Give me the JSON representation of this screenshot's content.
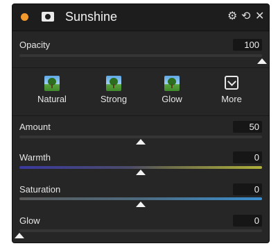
{
  "panel": {
    "title": "Sunshine",
    "accent_color": "#f39a2e",
    "icons": [
      "mask-icon",
      "gear-icon",
      "undo-icon",
      "close-icon"
    ]
  },
  "opacity": {
    "label": "Opacity",
    "value": "100",
    "level": 1.0
  },
  "presets": [
    {
      "label": "Natural",
      "icon": "tree-thumbnail-icon"
    },
    {
      "label": "Strong",
      "icon": "tree-thumbnail-icon"
    },
    {
      "label": "Glow",
      "icon": "tree-thumbnail-icon"
    },
    {
      "label": "More",
      "icon": "chevron-down-box-icon"
    }
  ],
  "sliders": {
    "amount": {
      "label": "Amount",
      "value": "50",
      "level": 0.5
    },
    "warmth": {
      "label": "Warmth",
      "value": "0",
      "level": 0.5,
      "colors": [
        "#3a3aa0",
        "#b0b03a"
      ]
    },
    "saturation": {
      "label": "Saturation",
      "value": "0",
      "level": 0.5,
      "colors": [
        "#5a5a5a",
        "#3a8fd0"
      ]
    },
    "glow": {
      "label": "Glow",
      "value": "0",
      "level": 0.0
    }
  }
}
